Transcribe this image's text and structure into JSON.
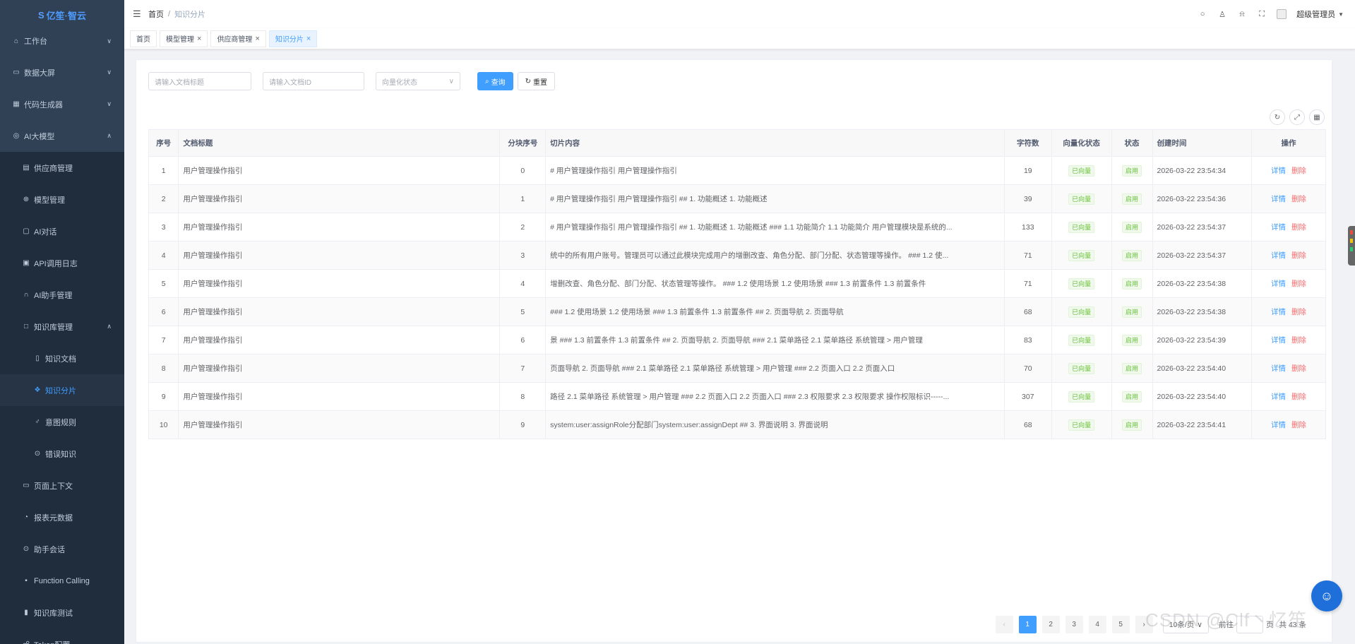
{
  "logo": {
    "text": "亿笙·智云",
    "prefix": "S"
  },
  "sidebar": {
    "items": [
      {
        "icon": "⌂",
        "label": "工作台",
        "chev": "∨",
        "type": "top"
      },
      {
        "icon": "▭",
        "label": "数据大屏",
        "chev": "∨",
        "type": "top"
      },
      {
        "icon": "▦",
        "label": "代码生成器",
        "chev": "∨",
        "type": "top"
      },
      {
        "icon": "◎",
        "label": "AI大模型",
        "chev": "∧",
        "type": "top"
      },
      {
        "icon": "▤",
        "label": "供应商管理",
        "chev": "",
        "type": "sub"
      },
      {
        "icon": "⊕",
        "label": "模型管理",
        "chev": "",
        "type": "sub"
      },
      {
        "icon": "▢",
        "label": "AI对话",
        "chev": "",
        "type": "sub"
      },
      {
        "icon": "▣",
        "label": "API调用日志",
        "chev": "",
        "type": "sub"
      },
      {
        "icon": "∩",
        "label": "AI助手管理",
        "chev": "",
        "type": "sub"
      },
      {
        "icon": "□",
        "label": "知识库管理",
        "chev": "∧",
        "type": "sub"
      },
      {
        "icon": "▯",
        "label": "知识文档",
        "chev": "",
        "type": "sub2"
      },
      {
        "icon": "❖",
        "label": "知识分片",
        "chev": "",
        "type": "sub2",
        "active": true
      },
      {
        "icon": "♂",
        "label": "意图规则",
        "chev": "",
        "type": "sub2"
      },
      {
        "icon": "⊙",
        "label": "错误知识",
        "chev": "",
        "type": "sub2"
      },
      {
        "icon": "▭",
        "label": "页面上下文",
        "chev": "",
        "type": "sub"
      },
      {
        "icon": "◔",
        "label": "报表元数据",
        "chev": "",
        "type": "sub"
      },
      {
        "icon": "⊙",
        "label": "助手会话",
        "chev": "",
        "type": "sub"
      },
      {
        "icon": "▪",
        "label": "Function Calling",
        "chev": "",
        "type": "sub"
      },
      {
        "icon": "▮",
        "label": "知识库测试",
        "chev": "",
        "type": "sub"
      },
      {
        "icon": "☍",
        "label": "Token配置",
        "chev": "",
        "type": "sub"
      }
    ]
  },
  "header": {
    "breadcrumb_home": "首页",
    "breadcrumb_sep": "/",
    "breadcrumb_current": "知识分片",
    "username": "超级管理员"
  },
  "tags": [
    {
      "label": "首页",
      "closable": false
    },
    {
      "label": "模型管理",
      "closable": true
    },
    {
      "label": "供应商管理",
      "closable": true
    },
    {
      "label": "知识分片",
      "closable": true,
      "active": true
    }
  ],
  "search": {
    "title_placeholder": "请输入文档标题",
    "id_placeholder": "请输入文档ID",
    "status_placeholder": "向量化状态",
    "query_label": "查询",
    "reset_label": "重置"
  },
  "table": {
    "headers": [
      "序号",
      "文档标题",
      "分块序号",
      "切片内容",
      "字符数",
      "向量化状态",
      "状态",
      "创建时间",
      "操作"
    ],
    "rows": [
      {
        "no": "1",
        "title": "用户管理操作指引",
        "chunk": "0",
        "content": "# 用户管理操作指引 用户管理操作指引",
        "chars": "19",
        "vec": "已向量",
        "status": "启用",
        "time": "2026-03-22 23:54:34"
      },
      {
        "no": "2",
        "title": "用户管理操作指引",
        "chunk": "1",
        "content": "# 用户管理操作指引 用户管理操作指引 ## 1. 功能概述 1. 功能概述",
        "chars": "39",
        "vec": "已向量",
        "status": "启用",
        "time": "2026-03-22 23:54:36"
      },
      {
        "no": "3",
        "title": "用户管理操作指引",
        "chunk": "2",
        "content": "# 用户管理操作指引 用户管理操作指引 ## 1. 功能概述 1. 功能概述 ### 1.1 功能简介 1.1 功能简介 用户管理模块是系统的...",
        "chars": "133",
        "vec": "已向量",
        "status": "启用",
        "time": "2026-03-22 23:54:37"
      },
      {
        "no": "4",
        "title": "用户管理操作指引",
        "chunk": "3",
        "content": "统中的所有用户账号。管理员可以通过此模块完成用户的增删改查、角色分配、部门分配、状态管理等操作。 ### 1.2 使...",
        "chars": "71",
        "vec": "已向量",
        "status": "启用",
        "time": "2026-03-22 23:54:37"
      },
      {
        "no": "5",
        "title": "用户管理操作指引",
        "chunk": "4",
        "content": "增删改查、角色分配、部门分配、状态管理等操作。 ### 1.2 使用场景 1.2 使用场景 ### 1.3 前置条件 1.3 前置条件",
        "chars": "71",
        "vec": "已向量",
        "status": "启用",
        "time": "2026-03-22 23:54:38"
      },
      {
        "no": "6",
        "title": "用户管理操作指引",
        "chunk": "5",
        "content": "### 1.2 使用场景 1.2 使用场景 ### 1.3 前置条件 1.3 前置条件 ## 2. 页面导航 2. 页面导航",
        "chars": "68",
        "vec": "已向量",
        "status": "启用",
        "time": "2026-03-22 23:54:38"
      },
      {
        "no": "7",
        "title": "用户管理操作指引",
        "chunk": "6",
        "content": "景 ### 1.3 前置条件 1.3 前置条件 ## 2. 页面导航 2. 页面导航 ### 2.1 菜单路径 2.1 菜单路径 系统管理 > 用户管理",
        "chars": "83",
        "vec": "已向量",
        "status": "启用",
        "time": "2026-03-22 23:54:39"
      },
      {
        "no": "8",
        "title": "用户管理操作指引",
        "chunk": "7",
        "content": "页面导航 2. 页面导航 ### 2.1 菜单路径 2.1 菜单路径 系统管理 > 用户管理 ### 2.2 页面入口 2.2 页面入口",
        "chars": "70",
        "vec": "已向量",
        "status": "启用",
        "time": "2026-03-22 23:54:40"
      },
      {
        "no": "9",
        "title": "用户管理操作指引",
        "chunk": "8",
        "content": "路径 2.1 菜单路径 系统管理 > 用户管理 ### 2.2 页面入口 2.2 页面入口 ### 2.3 权限要求 2.3 权限要求 操作权限标识-----...",
        "chars": "307",
        "vec": "已向量",
        "status": "启用",
        "time": "2026-03-22 23:54:40"
      },
      {
        "no": "10",
        "title": "用户管理操作指引",
        "chunk": "9",
        "content": "system:user:assignRole分配部门system:user:assignDept ## 3. 界面说明 3. 界面说明",
        "chars": "68",
        "vec": "已向量",
        "status": "启用",
        "time": "2026-03-22 23:54:41"
      }
    ],
    "action_detail": "详情",
    "action_delete": "删除"
  },
  "pager": {
    "prev": "‹",
    "next": "›",
    "pages": [
      "1",
      "2",
      "3",
      "4",
      "5"
    ],
    "current": "1",
    "size_label": "10条/页",
    "goto_label": "前往",
    "goto_suffix": "页",
    "total_label": "共 43 条"
  },
  "watermark": "CSDN @Clf丶忆笙",
  "colors": {
    "primary": "#409eff",
    "sidebar": "#304156",
    "danger": "#f56c6c",
    "success": "#67c23a"
  }
}
